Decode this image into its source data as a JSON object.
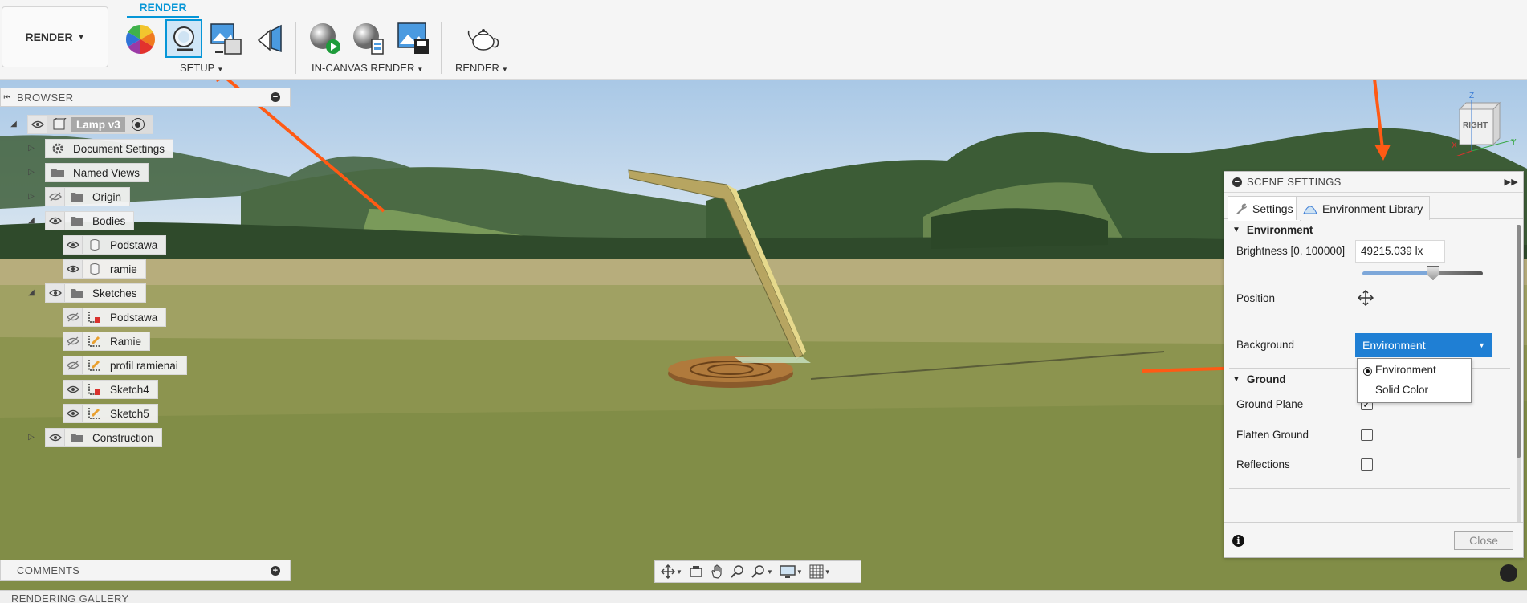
{
  "toolbar": {
    "workspace": "RENDER",
    "active_tab": "RENDER",
    "groups": [
      {
        "label": "SETUP",
        "icons": [
          "scene-settings-icon",
          "appearance-icon",
          "texture-map-icon",
          "decal-icon"
        ]
      },
      {
        "label": "IN-CANVAS RENDER",
        "icons": [
          "in-canvas-render-icon",
          "in-canvas-settings-icon",
          "capture-image-icon"
        ]
      },
      {
        "label": "RENDER",
        "icons": [
          "render-teapot-icon"
        ]
      }
    ]
  },
  "browser": {
    "title": "BROWSER",
    "root": "Lamp v3",
    "items": [
      {
        "label": "Document Settings",
        "icon": "gear-icon"
      },
      {
        "label": "Named Views",
        "icon": "folder-icon"
      },
      {
        "label": "Origin",
        "icon": "folder-icon"
      },
      {
        "label": "Bodies",
        "icon": "folder-icon"
      },
      {
        "label": "Podstawa",
        "icon": "body-icon"
      },
      {
        "label": "ramie",
        "icon": "body-icon"
      },
      {
        "label": "Sketches",
        "icon": "folder-icon"
      },
      {
        "label": "Podstawa",
        "icon": "sketch-icon"
      },
      {
        "label": "Ramie",
        "icon": "sketch-icon"
      },
      {
        "label": "profil ramienai",
        "icon": "sketch-icon"
      },
      {
        "label": "Sketch4",
        "icon": "sketch-icon"
      },
      {
        "label": "Sketch5",
        "icon": "sketch-icon"
      },
      {
        "label": "Construction",
        "icon": "folder-icon"
      }
    ]
  },
  "comments": {
    "title": "COMMENTS"
  },
  "gallery": {
    "title": "RENDERING GALLERY"
  },
  "viewcube": {
    "face": "RIGHT",
    "axis_z": "Z",
    "axis_x": "X",
    "axis_y": "Y"
  },
  "scene_settings": {
    "title": "SCENE SETTINGS",
    "tabs": [
      "Settings",
      "Environment Library"
    ],
    "environment": {
      "title": "Environment",
      "brightness_label": "Brightness [0, 100000]",
      "brightness_value": "49215.039 lx",
      "brightness_fraction": 0.49,
      "position_label": "Position",
      "background_label": "Background",
      "background_value": "Environment",
      "background_options": [
        "Environment",
        "Solid Color"
      ]
    },
    "ground": {
      "title": "Ground",
      "ground_plane_label": "Ground Plane",
      "ground_plane_checked": true,
      "flatten_ground_label": "Flatten Ground",
      "flatten_ground_checked": false,
      "reflections_label": "Reflections",
      "reflections_checked": false
    },
    "close_label": "Close"
  },
  "colors": {
    "accent": "#0696d7",
    "select": "#1f7fd4",
    "annotation_arrow": "#ff5a14"
  }
}
